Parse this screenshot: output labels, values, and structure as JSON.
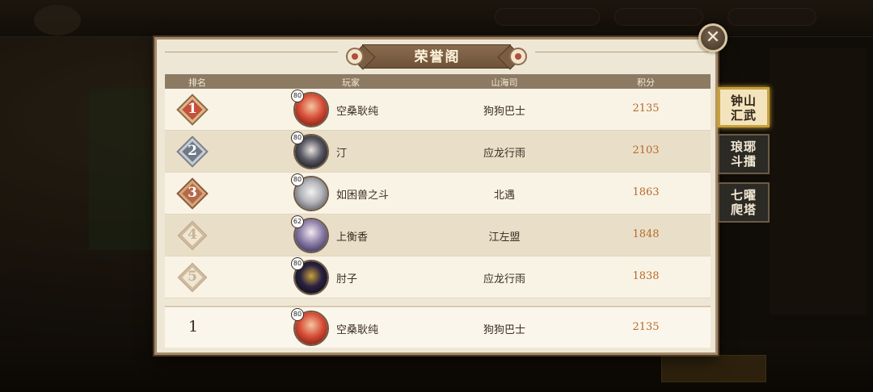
{
  "panel": {
    "title": "荣誉阁",
    "headers": {
      "rank": "排名",
      "player": "玩家",
      "guild": "山海司",
      "score": "积分"
    }
  },
  "rows": [
    {
      "rank": "1",
      "level": "80",
      "name": "空桑耿纯",
      "guild": "狗狗巴士",
      "score": "2135"
    },
    {
      "rank": "2",
      "level": "80",
      "name": "汀",
      "guild": "应龙行雨",
      "score": "2103"
    },
    {
      "rank": "3",
      "level": "80",
      "name": "如困兽之斗",
      "guild": "北遇",
      "score": "1863"
    },
    {
      "rank": "4",
      "level": "62",
      "name": "上衡香",
      "guild": "江左盟",
      "score": "1848"
    },
    {
      "rank": "5",
      "level": "80",
      "name": "肘子",
      "guild": "应龙行雨",
      "score": "1838"
    }
  ],
  "self": {
    "rank": "1",
    "level": "80",
    "name": "空桑耿纯",
    "guild": "狗狗巴士",
    "score": "2135"
  },
  "tabs": [
    {
      "label": "钟山汇武",
      "active": true
    },
    {
      "label": "琅琊斗擂",
      "active": false
    },
    {
      "label": "七曜爬塔",
      "active": false
    }
  ],
  "close_icon": "close-icon",
  "colors": {
    "score": "#b46a2a",
    "active_tab_border": "#c9a13a",
    "panel_bg": "#efe7d6"
  }
}
